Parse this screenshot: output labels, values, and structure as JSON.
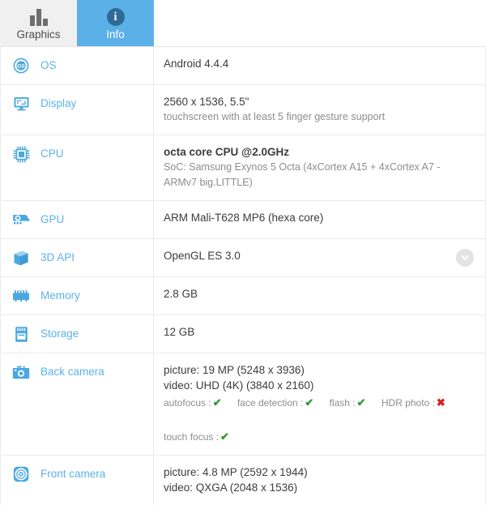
{
  "tabs": [
    {
      "label": "Graphics",
      "icon": "bar-chart-icon",
      "active": false
    },
    {
      "label": "Info",
      "icon": "info-circle-icon",
      "active": true
    }
  ],
  "colors": {
    "accent": "#5bb0e8",
    "label_text": "#5bb3e8",
    "value_text": "#3c3c3c",
    "sub_text": "#8d8d8d",
    "yes": "#2e9b2e",
    "no": "#d81f1f",
    "tab_inactive_bg": "#f0f0f0",
    "border": "#e9ebec"
  },
  "rows": [
    {
      "label": "OS",
      "icon": "os-icon",
      "main": "Android 4.4.4",
      "sub": "",
      "features": []
    },
    {
      "label": "Display",
      "icon": "display-icon",
      "main": "2560 x 1536, 5.5\"",
      "sub": "touchscreen with at least 5 finger gesture support",
      "features": []
    },
    {
      "label": "CPU",
      "icon": "cpu-icon",
      "main": "octa core CPU @2.0GHz",
      "sub": "SoC: Samsung Exynos 5 Octa (4xCortex A15 + 4xCortex A7 - ARMv7 big.LITTLE)",
      "features": []
    },
    {
      "label": "GPU",
      "icon": "gpu-icon",
      "main": "ARM Mali-T628 MP6 (hexa core)",
      "sub": "",
      "features": []
    },
    {
      "label": "3D API",
      "icon": "cube-icon",
      "main": "OpenGL ES 3.0",
      "sub": "",
      "features": [],
      "expander": "chevron-down-icon"
    },
    {
      "label": "Memory",
      "icon": "memory-icon",
      "main": "2.8 GB",
      "sub": "",
      "features": []
    },
    {
      "label": "Storage",
      "icon": "storage-icon",
      "main": "12 GB",
      "sub": "",
      "features": []
    },
    {
      "label": "Back camera",
      "icon": "back-camera-icon",
      "main": "picture: 19 MP (5248 x 3936)",
      "main2": "video: UHD (4K) (3840 x 2160)",
      "features": [
        {
          "name": "autofocus :",
          "value": "yes"
        },
        {
          "name": "face detection :",
          "value": "yes"
        },
        {
          "name": "flash :",
          "value": "yes"
        },
        {
          "name": "HDR photo :",
          "value": "no"
        }
      ],
      "features2": [
        {
          "name": "touch focus :",
          "value": "yes"
        }
      ]
    },
    {
      "label": "Front camera",
      "icon": "front-camera-icon",
      "main": "picture: 4.8 MP (2592 x 1944)",
      "main2": "video: QXGA (2048 x 1536)",
      "features": []
    }
  ],
  "marks": {
    "yes": "✔",
    "no": "✖"
  }
}
